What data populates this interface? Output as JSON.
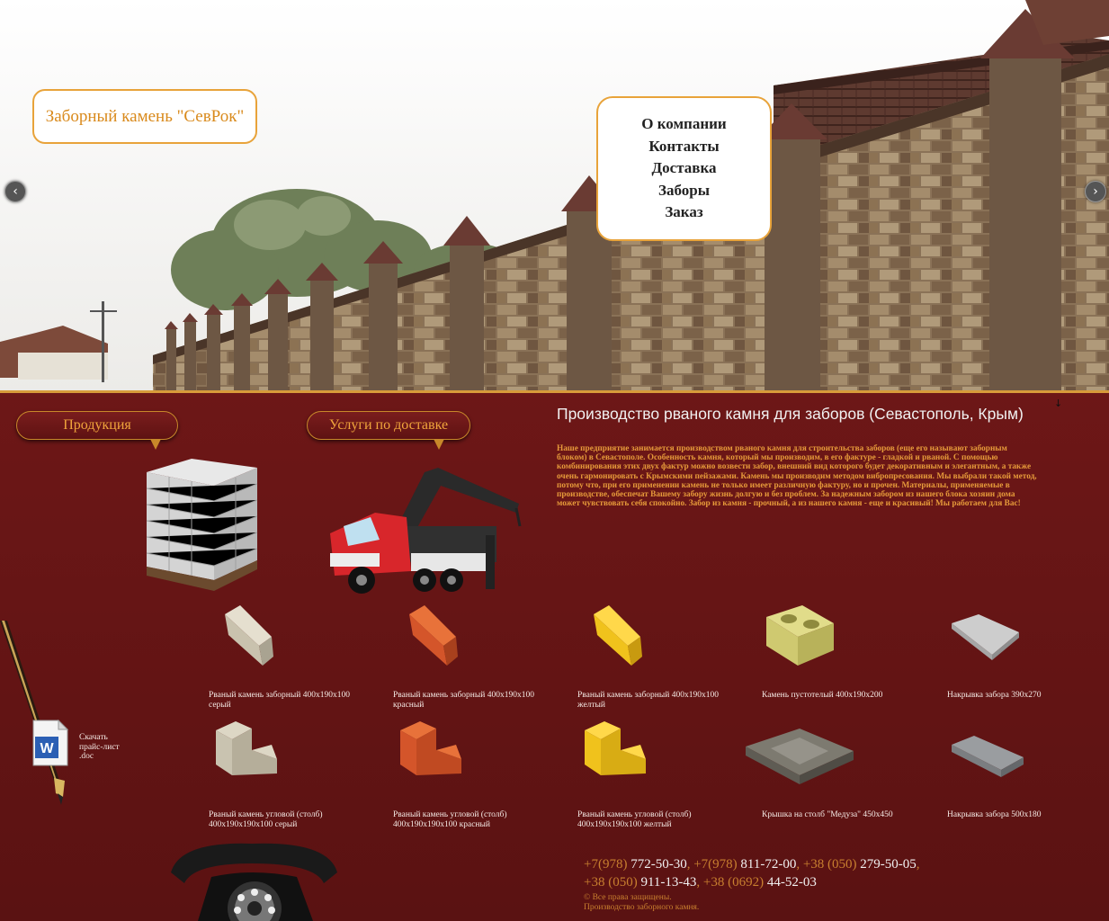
{
  "hero": {
    "logo_text": "Заборный камень \"СевРок\"",
    "nav": [
      "О компании",
      "Контакты",
      "Доставка",
      "Заборы",
      "Заказ"
    ],
    "prev_arrow": "‹",
    "next_arrow": "›"
  },
  "sections": {
    "products_label": "Продукция",
    "delivery_label": "Услуги по доставке"
  },
  "main": {
    "title": "Производство рваного камня для заборов (Севастополь, Крым)",
    "text": "Наше предприятие занимается производством рваного камня для строительства заборов (еще его называют заборным блоком) в Севастополе. Особенность камня, который мы производим, в его фактуре - гладкой и рваной. С помощью комбинирования этих двух фактур можно возвести забор, внешний вид которого будет декоративным и элегантным, а также очень гармонировать с Крымскими пейзажами. Камень мы производим методом вибропресования. Мы выбрали такой метод, потому что, при его применении камень не только имеет различную фактуру, но и прочен. Материалы, применяемые в производстве, обеспечат Вашему забору жизнь долгую и без проблем. За надежным забором из нашего блока хозяин дома может чувствовать себя спокойно. Забор из камня - прочный, а из нашего камня - еще и красивый! Мы работаем для Вас!",
    "mark": "↓"
  },
  "products_row1": [
    {
      "caption": "Рваный камень заборный 400х190х100 серый",
      "color": "#cfc8b6"
    },
    {
      "caption": "Рваный камень заборный 400х190х100 красный",
      "color": "#d0552a"
    },
    {
      "caption": "Рваный камень заборный 400х190х100 желтый",
      "color": "#f2c420"
    },
    {
      "caption": "Камень пустотелый 400х190х200",
      "color": "#d6d27a"
    },
    {
      "caption": "Накрывка забора 390х270",
      "color": "#bdbdbd"
    }
  ],
  "products_row2": [
    {
      "caption": "Рваный камень угловой (столб) 400х190х190х100 серый",
      "color": "#c9c3b0"
    },
    {
      "caption": "Рваный камень угловой (столб) 400х190х190х100 красный",
      "color": "#d4552a"
    },
    {
      "caption": "Рваный камень угловой (столб) 400х190х190х100 желтый",
      "color": "#f0c21c"
    },
    {
      "caption": "Крышка на столб \"Медуза\" 450х450",
      "color": "#7d7a70"
    },
    {
      "caption": "Накрывка забора 500х180",
      "color": "#9a9da0"
    }
  ],
  "price": {
    "text": "Скачать прайс-лист .doc",
    "icon": "word-doc-icon"
  },
  "contacts": {
    "phones_line1": [
      {
        "code": "+7(978)",
        "num": "772-50-30"
      },
      {
        "code": "+7(978)",
        "num": "811-72-00"
      },
      {
        "code": "+38 (050)",
        "num": "279-50-05"
      }
    ],
    "phones_line2": [
      {
        "code": "+38 (050)",
        "num": "911-13-43"
      },
      {
        "code": "+38 (0692)",
        "num": "44-52-03"
      }
    ],
    "copyright_1": "© Все права защищены.",
    "copyright_2": "Производство заборного камня."
  },
  "colors": {
    "accent": "#e8a33a",
    "background": "#5e1313",
    "text_orange": "#e69a3a"
  }
}
